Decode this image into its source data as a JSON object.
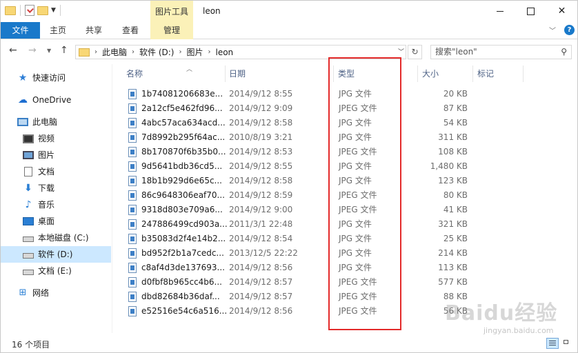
{
  "titlebar": {
    "tools_tab": "图片工具",
    "title": "leon"
  },
  "ribbon": {
    "tabs": [
      "文件",
      "主页",
      "共享",
      "查看",
      "管理"
    ]
  },
  "nav": {
    "breadcrumb": [
      "此电脑",
      "软件 (D:)",
      "图片",
      "leon"
    ],
    "search_placeholder": "搜索\"leon\""
  },
  "sidebar": {
    "items": [
      {
        "label": "快速访问",
        "icon": "star-icon"
      },
      {
        "label": "OneDrive",
        "icon": "cloud-icon"
      },
      {
        "label": "此电脑",
        "icon": "computer-icon"
      },
      {
        "label": "视频",
        "icon": "video-icon"
      },
      {
        "label": "图片",
        "icon": "picture-icon"
      },
      {
        "label": "文档",
        "icon": "document-icon"
      },
      {
        "label": "下载",
        "icon": "download-icon"
      },
      {
        "label": "音乐",
        "icon": "music-icon"
      },
      {
        "label": "桌面",
        "icon": "desktop-icon"
      },
      {
        "label": "本地磁盘 (C:)",
        "icon": "drive-icon"
      },
      {
        "label": "软件 (D:)",
        "icon": "drive-icon"
      },
      {
        "label": "文档 (E:)",
        "icon": "drive-icon"
      },
      {
        "label": "网络",
        "icon": "network-icon"
      }
    ],
    "selected": "软件 (D:)"
  },
  "columns": {
    "name": "名称",
    "date": "日期",
    "type": "类型",
    "size": "大小",
    "tags": "标记"
  },
  "files": [
    {
      "name": "1b74081206683e...",
      "date": "2014/9/12 8:55",
      "type": "JPG 文件",
      "size": "20 KB"
    },
    {
      "name": "2a12cf5e462fd96...",
      "date": "2014/9/12 9:09",
      "type": "JPEG 文件",
      "size": "87 KB"
    },
    {
      "name": "4abc57aca634acd...",
      "date": "2014/9/12 8:58",
      "type": "JPG 文件",
      "size": "54 KB"
    },
    {
      "name": "7d8992b295f64ac...",
      "date": "2010/8/19 3:21",
      "type": "JPG 文件",
      "size": "311 KB"
    },
    {
      "name": "8b170870f6b35b0...",
      "date": "2014/9/12 8:53",
      "type": "JPEG 文件",
      "size": "108 KB"
    },
    {
      "name": "9d5641bdb36cd5...",
      "date": "2014/9/12 8:55",
      "type": "JPG 文件",
      "size": "1,480 KB"
    },
    {
      "name": "18b1b929d6e65c...",
      "date": "2014/9/12 8:58",
      "type": "JPG 文件",
      "size": "123 KB"
    },
    {
      "name": "86c9648306eaf70...",
      "date": "2014/9/12 8:59",
      "type": "JPEG 文件",
      "size": "80 KB"
    },
    {
      "name": "9318d803e709a6...",
      "date": "2014/9/12 9:00",
      "type": "JPEG 文件",
      "size": "41 KB"
    },
    {
      "name": "247886499cd903a...",
      "date": "2011/3/1 22:48",
      "type": "JPG 文件",
      "size": "321 KB"
    },
    {
      "name": "b35083d2f4e14b2...",
      "date": "2014/9/12 8:54",
      "type": "JPG 文件",
      "size": "25 KB"
    },
    {
      "name": "bd952f2b1a7cedc...",
      "date": "2013/12/5 22:22",
      "type": "JPG 文件",
      "size": "214 KB"
    },
    {
      "name": "c8af4d3de137693...",
      "date": "2014/9/12 8:56",
      "type": "JPG 文件",
      "size": "113 KB"
    },
    {
      "name": "d0fbf8b965cc4b6...",
      "date": "2014/9/12 8:57",
      "type": "JPEG 文件",
      "size": "577 KB"
    },
    {
      "name": "dbd82684b36daf...",
      "date": "2014/9/12 8:57",
      "type": "JPEG 文件",
      "size": "88 KB"
    },
    {
      "name": "e52516e54c6a516...",
      "date": "2014/9/12 8:56",
      "type": "JPEG 文件",
      "size": "56 KB"
    }
  ],
  "status": {
    "item_count": "16 个项目"
  },
  "watermark": {
    "main": "Baidu经验",
    "sub": "jingyan.baidu.com"
  },
  "colors": {
    "file_tab": "#1979ca",
    "tools_tab": "#fbf1b8",
    "selected_item": "#cce8ff",
    "highlight_box": "#e32a2a"
  }
}
